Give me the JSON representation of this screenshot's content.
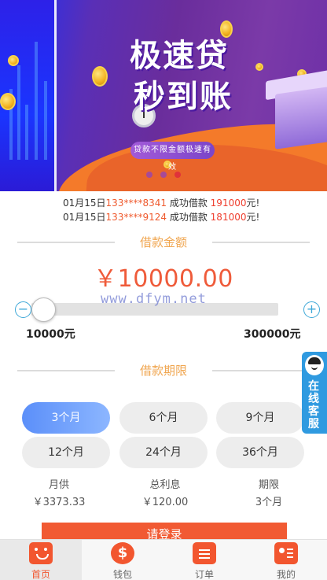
{
  "banner": {
    "title_line1": "极速贷",
    "title_line2": "秒到账",
    "subtitle": "贷款不限金额极速有效",
    "active_dot": 3
  },
  "ticker": [
    {
      "date": "01月15日",
      "phone": "133****8341",
      "text": "成功借款",
      "amount": "191000",
      "unit": "元!"
    },
    {
      "date": "01月15日",
      "phone": "133****9124",
      "text": "成功借款",
      "amount": "181000",
      "unit": "元!"
    }
  ],
  "loan_amount": {
    "heading": "借款金额",
    "value": "￥10000.00",
    "slider_fraction": 0.0,
    "min_label": "10000元",
    "max_label": "300000元",
    "minus_symbol": "−",
    "plus_symbol": "+"
  },
  "watermark": "www.dfym.net",
  "loan_period": {
    "heading": "借款期限",
    "options": [
      "3个月",
      "6个月",
      "9个月",
      "12个月",
      "24个月",
      "36个月"
    ],
    "selected": "3个月"
  },
  "summary": [
    {
      "label": "月供",
      "value": "￥3373.33"
    },
    {
      "label": "总利息",
      "value": "￥120.00"
    },
    {
      "label": "期限",
      "value": "3个月"
    }
  ],
  "apply_button": "请登录",
  "service": {
    "label": "在线客服",
    "icon": "agent-face-icon"
  },
  "nav": [
    {
      "label": "首页",
      "icon": "home-icon",
      "active": true
    },
    {
      "label": "钱包",
      "icon": "wallet-icon",
      "active": false
    },
    {
      "label": "订单",
      "icon": "order-icon",
      "active": false
    },
    {
      "label": "我的",
      "icon": "profile-icon",
      "active": false
    }
  ],
  "colors": {
    "accent": "#ef5b3a",
    "heading": "#f0a650",
    "period_active": "#5b8ff9",
    "service": "#2f9ae0",
    "nav_icon": "#f2562f"
  }
}
